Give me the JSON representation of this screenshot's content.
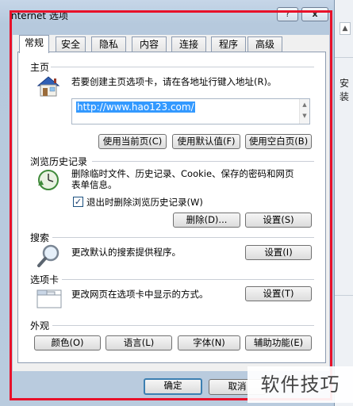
{
  "window": {
    "title": "nternet 选项",
    "help_label": "?",
    "close_label": "x"
  },
  "tabs": [
    {
      "label": "常规",
      "active": true
    },
    {
      "label": "安全"
    },
    {
      "label": "隐私"
    },
    {
      "label": "内容"
    },
    {
      "label": "连接"
    },
    {
      "label": "程序"
    },
    {
      "label": "高级"
    }
  ],
  "home": {
    "label": "主页",
    "description": "若要创建主页选项卡，请在各地址行键入地址(R)。",
    "url": "http://www.hao123.com/",
    "buttons": [
      "使用当前页(C)",
      "使用默认值(F)",
      "使用空白页(B)"
    ]
  },
  "history": {
    "label": "浏览历史记录",
    "description_line1": "删除临时文件、历史记录、Cookie、保存的密码和网页",
    "description_line2": "表单信息。",
    "checkbox_label": "退出时删除浏览历史记录(W)",
    "checkbox_checked": true,
    "delete_button": "删除(D)...",
    "settings_button": "设置(S)"
  },
  "search": {
    "label": "搜索",
    "description": "更改默认的搜索提供程序。",
    "settings_button": "设置(I)"
  },
  "tabs_section": {
    "label": "选项卡",
    "description": "更改网页在选项卡中显示的方式。",
    "settings_button": "设置(T)"
  },
  "appearance": {
    "label": "外观",
    "buttons": [
      "颜色(O)",
      "语言(L)",
      "字体(N)",
      "辅助功能(E)"
    ]
  },
  "footer": {
    "ok_button": "确定",
    "cancel_button": "取消"
  },
  "background": {
    "side_text": "安装"
  },
  "watermark": "软件技巧",
  "colors": {
    "highlight_frame": "#e8112a",
    "selection": "#3399ff"
  }
}
